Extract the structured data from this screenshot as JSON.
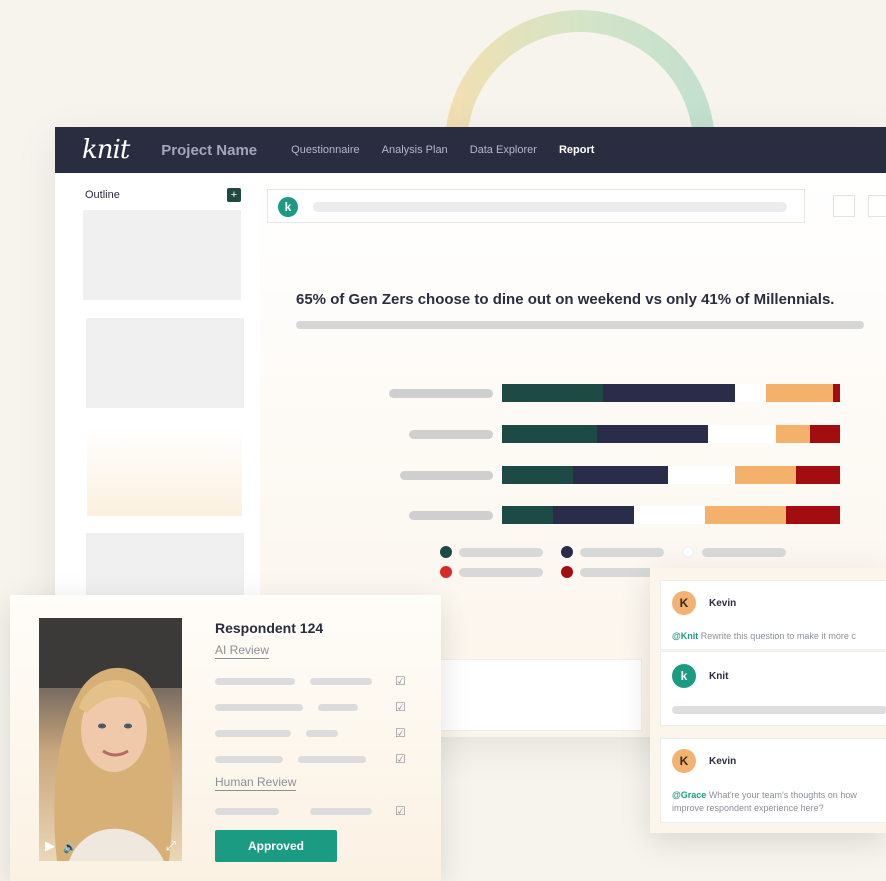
{
  "nav": {
    "logo": "knit",
    "project_name": "Project Name",
    "links": [
      "Questionnaire",
      "Analysis Plan",
      "Data Explorer",
      "Report"
    ],
    "active": "Report"
  },
  "sidebar": {
    "outline_label": "Outline",
    "add_icon": "+"
  },
  "search": {
    "badge": "k"
  },
  "report": {
    "headline": "65% of Gen Zers choose to dine out on weekend vs only 41% of Millennials."
  },
  "chart_data": {
    "type": "bar",
    "stacked": true,
    "horizontal": true,
    "categories": [
      "",
      "",
      "",
      ""
    ],
    "series_colors": [
      "#1d4a44",
      "#2a2d4a",
      "#ffffff",
      "#f4b16c",
      "#a40d0f"
    ],
    "rows": [
      [
        0.3,
        0.39,
        0.09,
        0.2,
        0.02
      ],
      [
        0.28,
        0.33,
        0.2,
        0.1,
        0.09
      ],
      [
        0.21,
        0.28,
        0.2,
        0.18,
        0.13
      ],
      [
        0.15,
        0.24,
        0.21,
        0.24,
        0.16
      ]
    ]
  },
  "respondent": {
    "title": "Respondent 124",
    "ai_review_label": "AI Review",
    "human_review_label": "Human Review",
    "approved_label": "Approved",
    "play_icon": "▶",
    "volume_icon": "🔊",
    "expand_icon": "⤢"
  },
  "chat": {
    "messages": [
      {
        "avatar": "K",
        "name": "Kevin",
        "mention": "@Knit",
        "text": "Rewrite this question to make it more c"
      },
      {
        "avatar": "k",
        "name": "Knit"
      },
      {
        "avatar": "K",
        "name": "Kevin",
        "mention": "@Grace",
        "text": "What're your team's thoughts on how",
        "text2": "improve respondent experience here?"
      }
    ]
  }
}
